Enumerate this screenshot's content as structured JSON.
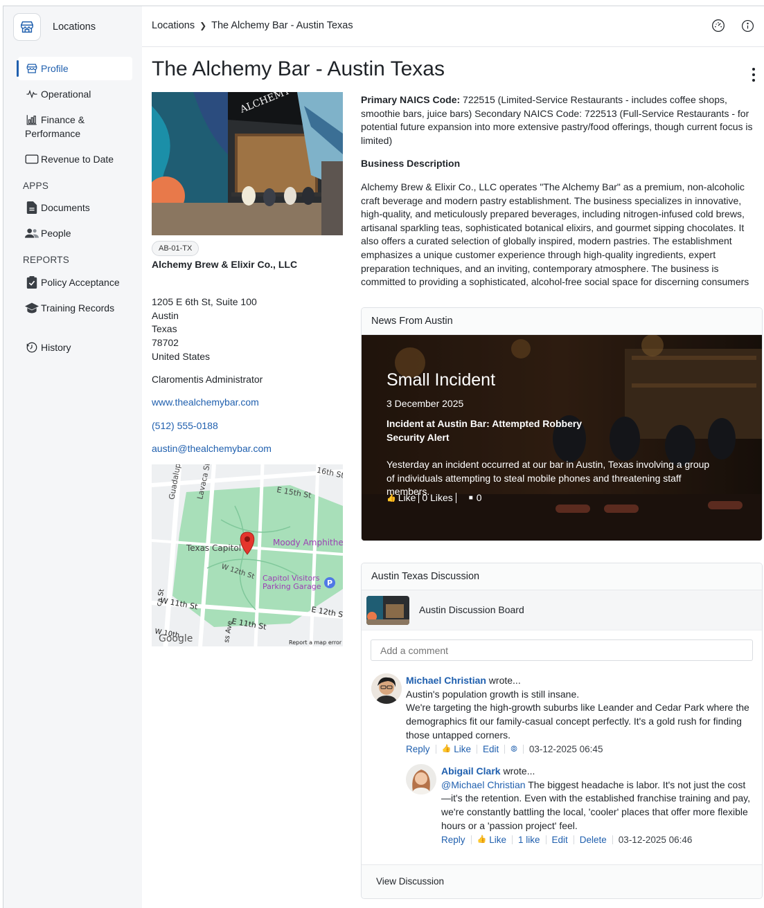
{
  "app": {
    "title": "Locations"
  },
  "breadcrumb": {
    "root": "Locations",
    "current": "The Alchemy Bar - Austin Texas"
  },
  "sidebar": {
    "items": [
      {
        "label": "Profile"
      },
      {
        "label": "Operational"
      },
      {
        "label": "Finance &"
      },
      {
        "label": "Performance"
      },
      {
        "label": "Revenue to Date"
      }
    ],
    "apps_label": "APPS",
    "apps": [
      {
        "label": "Documents"
      },
      {
        "label": "People"
      }
    ],
    "reports_label": "REPORTS",
    "reports": [
      {
        "label": "Policy Acceptance"
      },
      {
        "label": "Training Records"
      }
    ],
    "history": "History"
  },
  "page": {
    "title": "The Alchemy Bar - Austin Texas",
    "code": "AB-01-TX",
    "company": "Alchemy Brew & Elixir Co., LLC",
    "address": [
      "1205 E 6th St, Suite 100",
      "Austin",
      "Texas",
      "78702",
      "United States"
    ],
    "admin": "Claromentis Administrator",
    "website": "www.thealchemybar.com",
    "phone": "(512) 555-0188",
    "email": "austin@thealchemybar.com"
  },
  "map": {
    "labels": {
      "guadalupe": "Guadalupe",
      "lavaca": "Lavaca St",
      "sixteenth": "16th St",
      "fifteenth": "E 15th St",
      "capitol": "Texas Capitol",
      "amphitheater": "Moody Amphitheat",
      "w12th": "W 12th St",
      "visitors": "Capitol Visitors",
      "parking": "Parking Garage",
      "parking_letter": "P",
      "w11th": "W 11th St",
      "e12th": "E 12th St",
      "e11th": "E 11th St",
      "w10th": "W 10th",
      "ave": "ss Ave",
      "side_st": "ca St",
      "google": "Google",
      "report": "Report a map error"
    }
  },
  "description": {
    "naics_label": "Primary NAICS Code:",
    "naics_text": " 722515 (Limited-Service Restaurants - includes coffee shops, smoothie bars, juice bars) Secondary NAICS Code: 722513 (Full-Service Restaurants - for potential future expansion into more extensive pastry/food offerings, though current focus is limited)",
    "business_heading": "Business Description",
    "business_text": "Alchemy Brew & Elixir Co., LLC operates \"The Alchemy Bar\" as a premium, non-alcoholic craft beverage and modern pastry establishment. The business specializes in innovative, high-quality, and meticulously prepared beverages, including nitrogen-infused cold brews, artisanal sparkling teas, sophisticated botanical elixirs, and gourmet sipping chocolates. It also offers a curated selection of globally inspired, modern pastries. The establishment emphasizes a unique customer experience through high-quality ingredients, expert preparation techniques, and an inviting, contemporary atmosphere. The business is committed to providing a sophisticated, alcohol-free social space for discerning consumers"
  },
  "news": {
    "header": "News From Austin",
    "title": "Small Incident",
    "date": "3 December 2025",
    "subtitle1": "Incident at Austin Bar: Attempted Robbery",
    "subtitle2": "Security Alert",
    "body": "Yesterday an incident occurred at our bar in Austin, Texas involving a group of individuals attempting to steal mobile phones and threatening staff members.",
    "like": "Like",
    "likes": "0 Likes",
    "comments": "0"
  },
  "discussion": {
    "header": "Austin Texas Discussion",
    "board": "Austin Discussion Board",
    "placeholder": "Add a comment",
    "footer": "View Discussion",
    "comments": [
      {
        "author": "Michael Christian",
        "wrote": " wrote...",
        "line1": "Austin's population growth is still insane.",
        "line2": "We're targeting the high-growth suburbs like Leander and Cedar Park where the demographics fit our family-casual concept perfectly. It's a gold rush for finding those untapped corners.",
        "reply": "Reply",
        "like": "Like",
        "edit": "Edit",
        "timestamp": "03-12-2025 06:45"
      },
      {
        "author": "Abigail Clark",
        "wrote": " wrote...",
        "mention": "@Michael Christian",
        "text": " The biggest headache is labor. It's not just the cost—it's the retention. Even with the established franchise training and pay, we're constantly battling the local, 'cooler' places that offer more flexible hours or a 'passion project' feel.",
        "reply": "Reply",
        "like": "Like",
        "like_count": "1 like",
        "edit": "Edit",
        "delete": "Delete",
        "timestamp": "03-12-2025 06:46"
      }
    ]
  },
  "colors": {
    "accent": "#1f5fae",
    "sidebar_bg": "#f5f6f8",
    "map_park": "#a8dfb9"
  }
}
